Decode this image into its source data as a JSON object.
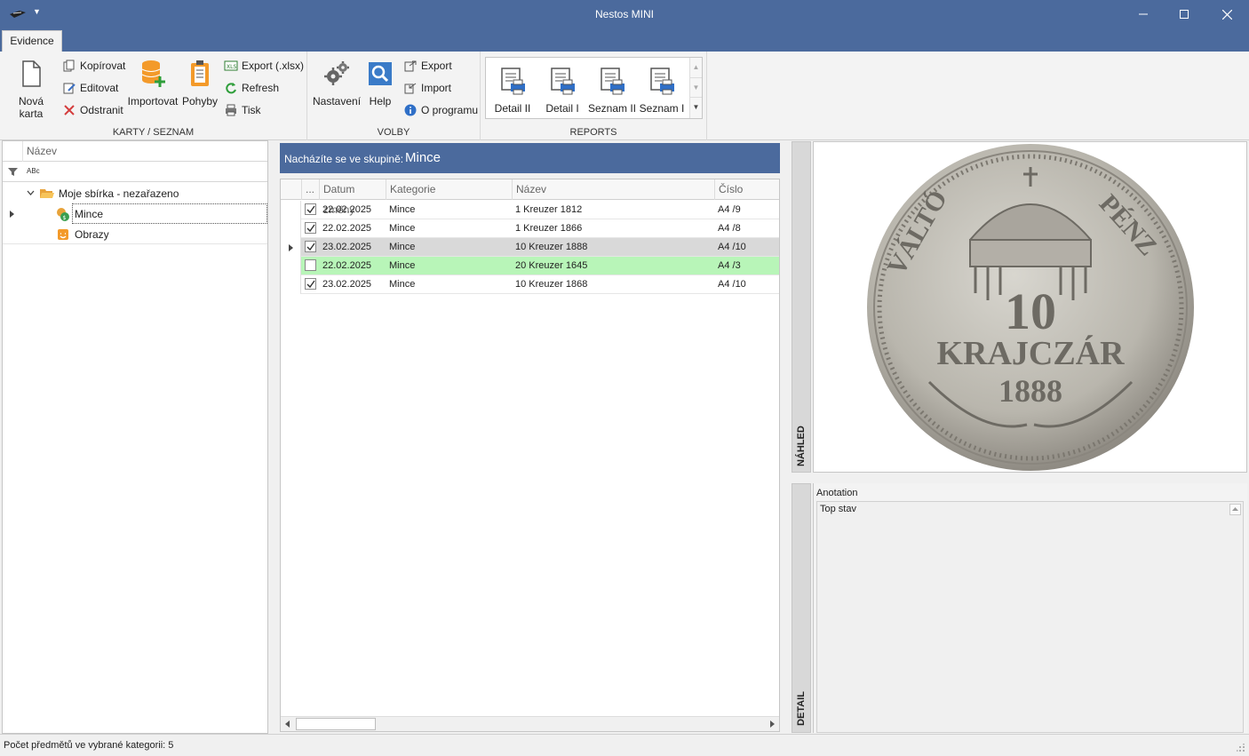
{
  "window": {
    "title": "Nestos MINI"
  },
  "ribbon": {
    "tab": "Evidence",
    "groups": {
      "karty": {
        "label": "KARTY / SEZNAM",
        "new_card": "Nová karta",
        "copy": "Kopírovat",
        "edit": "Editovat",
        "remove": "Odstranit",
        "import": "Importovat",
        "movements": "Pohyby",
        "export_xlsx": "Export (.xlsx)",
        "refresh": "Refresh",
        "print": "Tisk"
      },
      "volby": {
        "label": "VOLBY",
        "settings": "Nastavení",
        "help": "Help",
        "export": "Export",
        "import": "Import",
        "about": "O programu"
      },
      "reports": {
        "label": "REPORTS",
        "items": [
          "Detail II",
          "Detail I",
          "Seznam II",
          "Seznam I"
        ]
      }
    }
  },
  "tree": {
    "column": "Název",
    "filter_icon": "filter-icon",
    "filter_abc": "ABc",
    "root": "Moje sbírka - nezařazeno",
    "children": [
      "Mince",
      "Obrazy"
    ]
  },
  "group_banner": {
    "label": "Nacházíte se ve skupině:",
    "value": "Mince"
  },
  "grid": {
    "columns": [
      "...",
      "Datum změny",
      "Kategorie",
      "Název",
      "Číslo"
    ],
    "rows": [
      {
        "checked": true,
        "date": "22.02.2025",
        "category": "Mince",
        "name": "1 Kreuzer 1812",
        "number": "A4 /9",
        "state": "normal"
      },
      {
        "checked": true,
        "date": "22.02.2025",
        "category": "Mince",
        "name": "1 Kreuzer 1866",
        "number": "A4 /8",
        "state": "normal"
      },
      {
        "checked": true,
        "date": "23.02.2025",
        "category": "Mince",
        "name": "10 Kreuzer 1888",
        "number": "A4 /10",
        "state": "selected"
      },
      {
        "checked": false,
        "date": "22.02.2025",
        "category": "Mince",
        "name": "20 Kreuzer 1645",
        "number": "A4 /3",
        "state": "highlight"
      },
      {
        "checked": true,
        "date": "23.02.2025",
        "category": "Mince",
        "name": "10 Kreuzer 1868",
        "number": "A4 /10",
        "state": "normal"
      }
    ]
  },
  "preview": {
    "tab": "NÁHLED",
    "coin": {
      "top_left": "VÁLTÓ",
      "top_right": "PÉNZ",
      "value": "10",
      "unit": "KRAJCZÁR",
      "year": "1888"
    }
  },
  "detail": {
    "tab": "DETAIL",
    "annotation_label": "Anotation",
    "annotation_text": "Top stav"
  },
  "status": {
    "text": "Počet předmětů ve vybrané kategorii: 5"
  },
  "colors": {
    "accent": "#4b6a9d",
    "selected_row": "#d9d9d9",
    "highlight_row": "#b8f5b8"
  }
}
